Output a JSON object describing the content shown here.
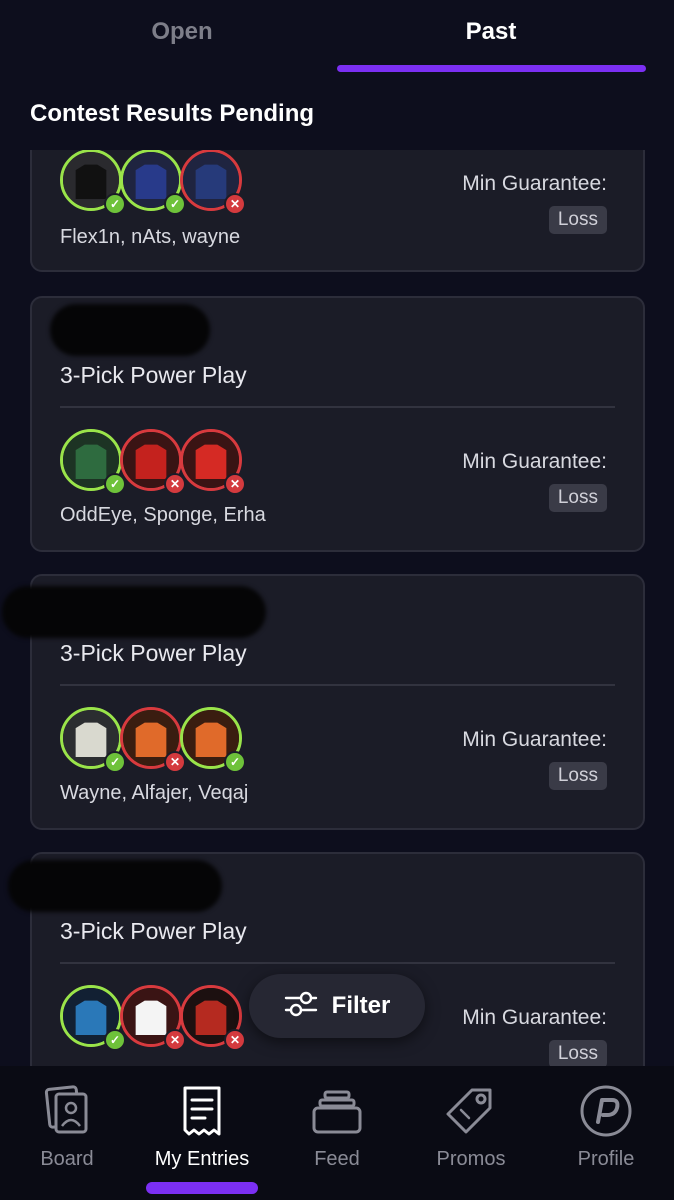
{
  "tabs": {
    "open": "Open",
    "past": "Past"
  },
  "section_title": "Contest Results Pending",
  "cards": [
    {
      "title": "",
      "players": "Flex1n, nAts, wayne",
      "min_guarantee_label": "Min Guarantee:",
      "result": "Loss"
    },
    {
      "title": "3-Pick Power Play",
      "players": "OddEye, Sponge, Erha",
      "min_guarantee_label": "Min Guarantee:",
      "result": "Loss"
    },
    {
      "title": "3-Pick Power Play",
      "players": "Wayne, Alfajer, Veqaj",
      "min_guarantee_label": "Min Guarantee:",
      "result": "Loss"
    },
    {
      "title": "3-Pick Power Play",
      "players": "",
      "min_guarantee_label": "Min Guarantee:",
      "result": "Loss"
    }
  ],
  "filter": {
    "label": "Filter",
    "icon": "sliders-icon"
  },
  "bottom_nav": {
    "items": [
      {
        "label": "Board",
        "icon": "board-cards-icon"
      },
      {
        "label": "My Entries",
        "icon": "receipt-icon"
      },
      {
        "label": "Feed",
        "icon": "stack-icon"
      },
      {
        "label": "Promos",
        "icon": "tag-icon"
      },
      {
        "label": "Profile",
        "icon": "profile-logo-icon"
      }
    ],
    "active": "My Entries"
  },
  "colors": {
    "accent": "#7b2ff3",
    "win": "#9ae44a",
    "loss": "#d83a3e",
    "card_bg": "#1b1c27",
    "page_bg": "#0d0e1d"
  }
}
